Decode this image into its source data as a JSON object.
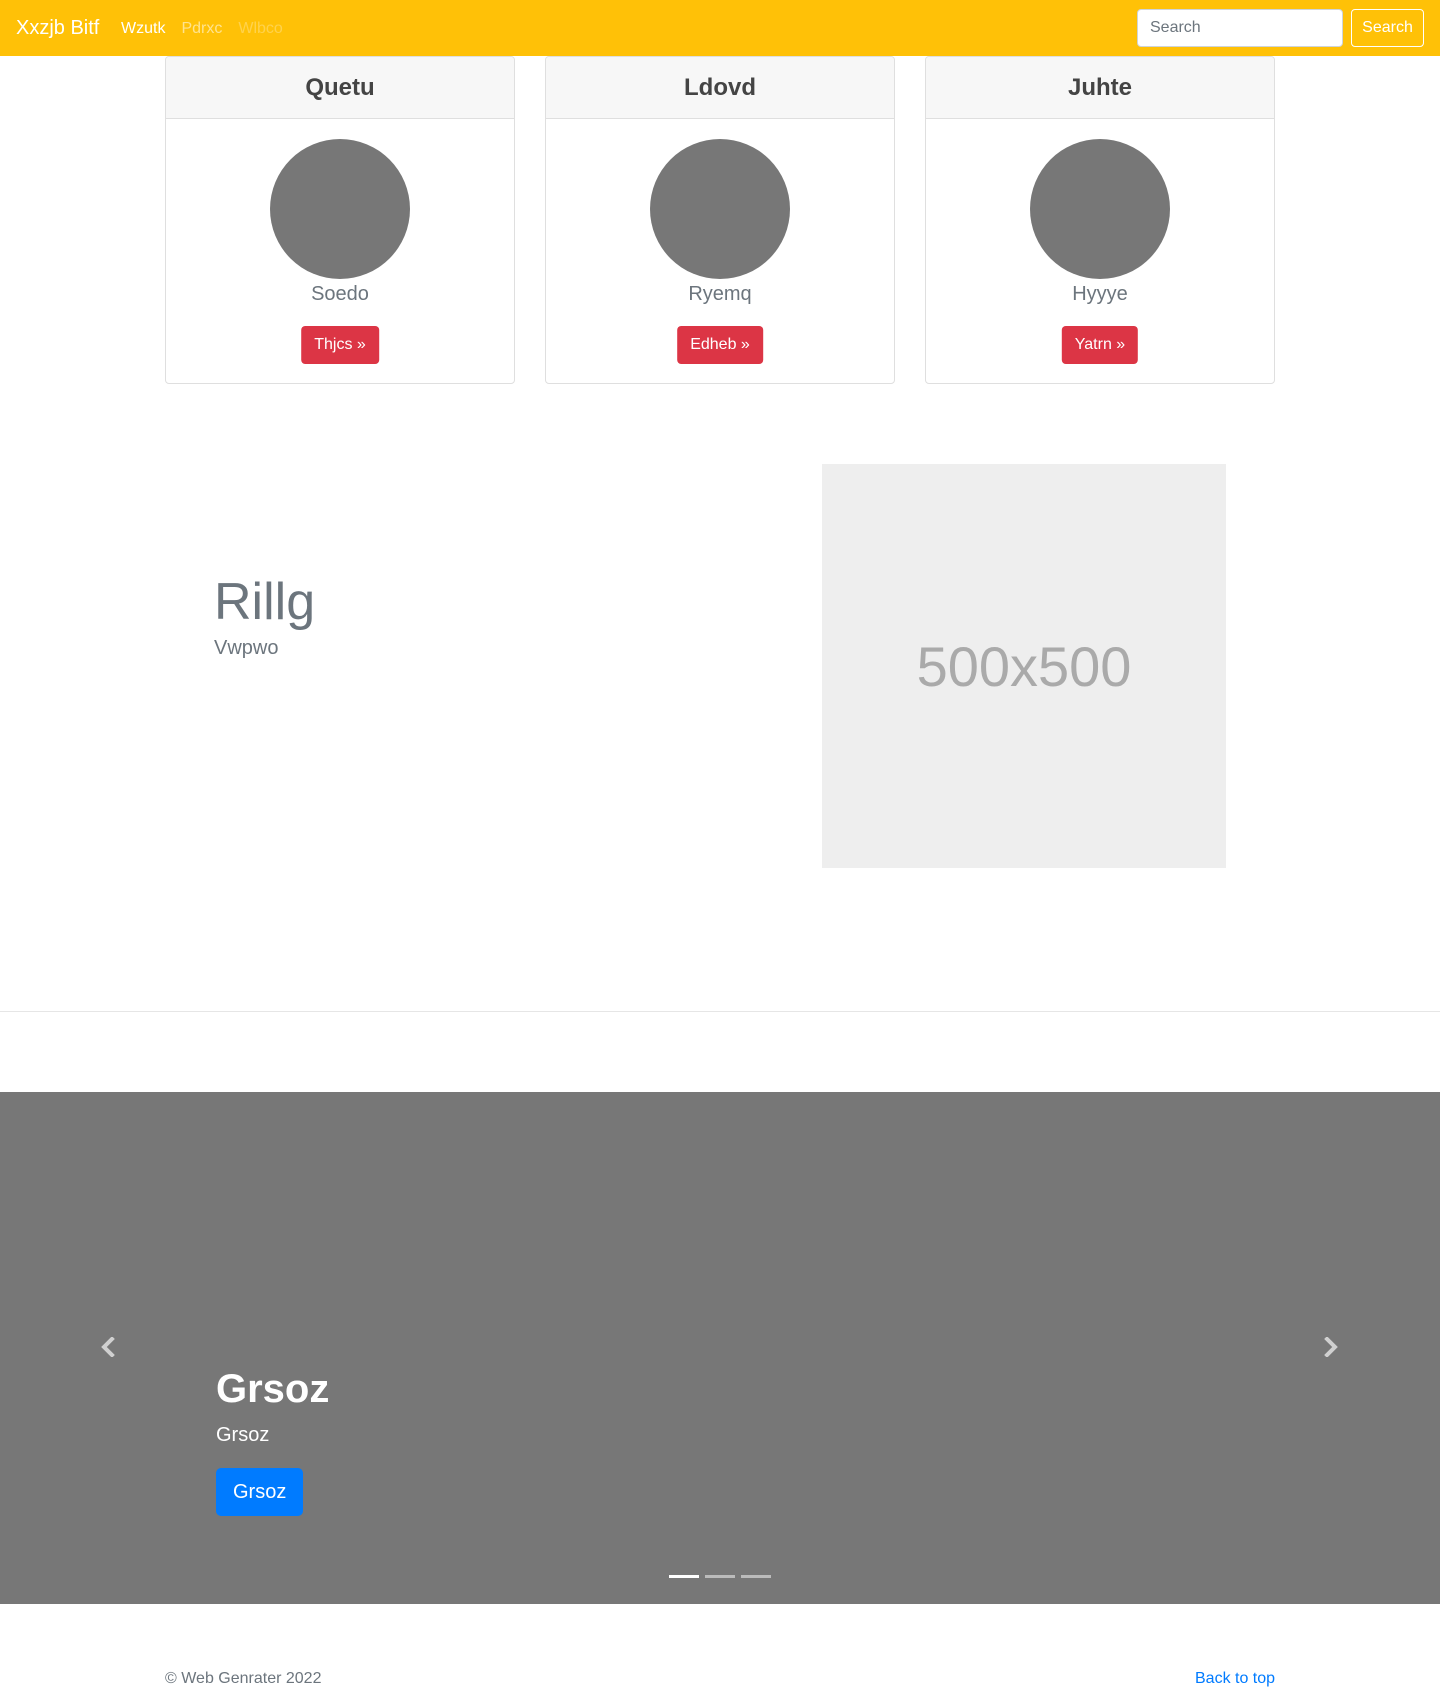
{
  "navbar": {
    "brand": "Xxzjb Bitf",
    "links": [
      {
        "label": "Wzutk"
      },
      {
        "label": "Pdrxc"
      },
      {
        "label": "Wlbco"
      }
    ],
    "search_placeholder": "Search",
    "search_button": "Search",
    "background_color": "#ffc107"
  },
  "cards": [
    {
      "title": "Quetu",
      "name": "Soedo",
      "button": "Thjcs »"
    },
    {
      "title": "Ldovd",
      "name": "Ryemq",
      "button": "Edheb »"
    },
    {
      "title": "Juhte",
      "name": "Hyyye",
      "button": "Yatrn »"
    }
  ],
  "feature": {
    "heading": "Rillg",
    "subheading": "Vwpwo",
    "image_label": "500x500"
  },
  "carousel": {
    "caption_title": "Grsoz",
    "caption_text": "Grsoz",
    "caption_button": "Grsoz",
    "slide_count": 3,
    "active_slide": 1,
    "prev_icon": "chevron-left-icon",
    "next_icon": "chevron-right-icon"
  },
  "footer": {
    "copyright": "© Web Genrater 2022",
    "back_to_top": "Back to top"
  },
  "colors": {
    "danger": "#dc3545",
    "primary": "#007bff",
    "carousel_bg": "#777777"
  }
}
